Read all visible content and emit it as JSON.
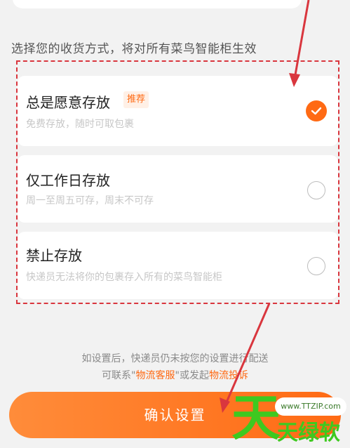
{
  "section_title": "选择您的收货方式，将对所有菜鸟智能柜生效",
  "options": [
    {
      "title": "总是愿意存放",
      "badge": "推荐",
      "desc": "免费存放，随时可取包裹",
      "selected": true
    },
    {
      "title": "仅工作日存放",
      "desc": "周一至周五可存，周末不可存",
      "selected": false
    },
    {
      "title": "禁止存放",
      "desc": "快递员无法将你的包裹存入所有的菜鸟智能柜",
      "selected": false
    }
  ],
  "hint": {
    "line1": "如设置后，快递员仍未按您的设置进行配送",
    "line2_prefix": "可联系\"",
    "link1": "物流客服",
    "line2_mid": "\"或发起",
    "link2": "物流投诉"
  },
  "confirm_label": "确认设置",
  "watermark": {
    "big": "天",
    "url": "www.TTZIP.com",
    "small": "天绿软"
  },
  "colors": {
    "accent": "#ff6a14",
    "annotation": "#d9363e",
    "watermark": "#3ec920"
  }
}
